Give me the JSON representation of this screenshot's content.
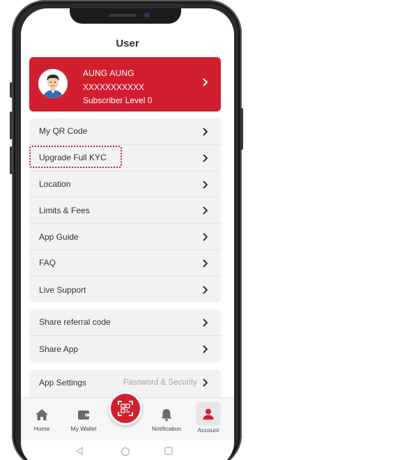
{
  "header": {
    "title": "User"
  },
  "profile": {
    "name": "AUNG AUNG",
    "phone": "XXXXXXXXXXX",
    "level": "Subscriber Level 0"
  },
  "menu_main": [
    {
      "label": "My QR Code",
      "icon": "chevron-right-icon"
    },
    {
      "label": "Upgrade Full KYC",
      "icon": "chevron-right-icon",
      "highlighted": true
    },
    {
      "label": "Location",
      "icon": "chevron-right-icon"
    },
    {
      "label": "Limits & Fees",
      "icon": "chevron-right-icon"
    },
    {
      "label": "App Guide",
      "icon": "chevron-right-icon"
    },
    {
      "label": "FAQ",
      "icon": "chevron-right-icon"
    },
    {
      "label": "Live Support",
      "icon": "chevron-right-icon"
    }
  ],
  "menu_share": [
    {
      "label": "Share referral code",
      "icon": "chevron-right-icon"
    },
    {
      "label": "Share App",
      "icon": "chevron-right-icon"
    }
  ],
  "menu_settings": [
    {
      "label": "App Settings",
      "sub": "Password & Security",
      "icon": "chevron-right-icon"
    }
  ],
  "nav": {
    "home": "Home",
    "wallet": "My Wallet",
    "notification": "Notification",
    "account": "Account",
    "active": "account"
  },
  "colors": {
    "brand_red": "#d11f2f",
    "highlight_outline": "#b3242e",
    "menu_bg": "#f2f2f3",
    "text": "#333333",
    "muted": "#a6a6a9"
  }
}
